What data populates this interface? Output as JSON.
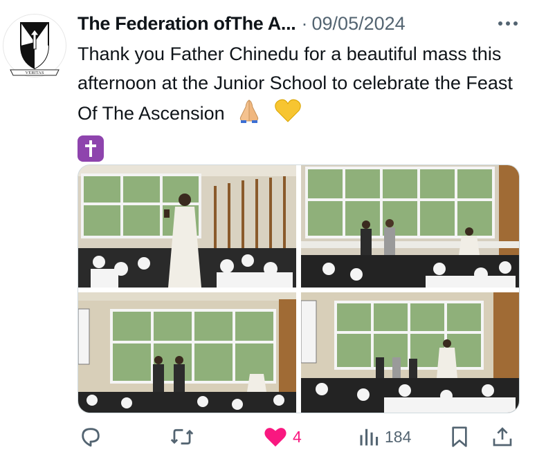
{
  "post": {
    "author_name": "The Federation ofThe A...",
    "separator": "·",
    "date": "09/05/2024",
    "avatar_text": "VERITAS",
    "text": "Thank you Father Chinedu for a beautiful mass this afternoon at the Junior School to celebrate the Feast Of The Ascension",
    "emojis": [
      "folded-hands-emoji",
      "yellow-heart-emoji",
      "latin-cross-emoji"
    ]
  },
  "media": [
    {
      "label": "photo-1",
      "description_icon": "image"
    },
    {
      "label": "photo-2",
      "description_icon": "image"
    },
    {
      "label": "photo-3",
      "description_icon": "image"
    },
    {
      "label": "photo-4",
      "description_icon": "image"
    }
  ],
  "actions": {
    "reply_count": "",
    "repost_count": "",
    "like_count": "4",
    "views_count": "184"
  },
  "colors": {
    "like": "#f91880",
    "muted": "#536471",
    "text": "#0f1419",
    "cross_badge": "#8e44ad"
  }
}
